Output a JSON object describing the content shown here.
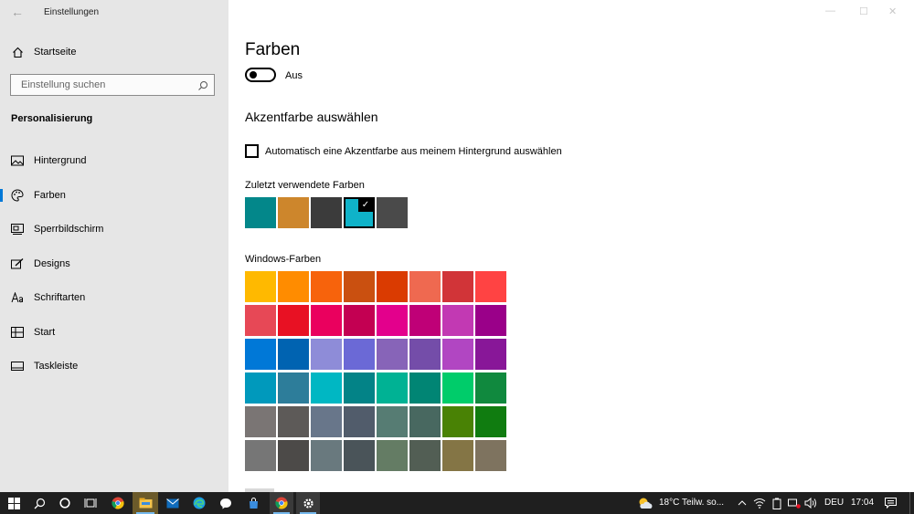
{
  "window": {
    "title": "Einstellungen",
    "back_glyph": "←",
    "minimize_glyph": "—",
    "maximize_glyph": "☐",
    "close_glyph": "✕"
  },
  "sidebar": {
    "home": {
      "label": "Startseite",
      "icon": "home-icon"
    },
    "search": {
      "placeholder": "Einstellung suchen",
      "icon": "search-icon"
    },
    "section": "Personalisierung",
    "items": [
      {
        "label": "Hintergrund",
        "icon": "picture-icon"
      },
      {
        "label": "Farben",
        "icon": "palette-icon",
        "active": true
      },
      {
        "label": "Sperrbildschirm",
        "icon": "lockscreen-icon"
      },
      {
        "label": "Designs",
        "icon": "brush-icon"
      },
      {
        "label": "Schriftarten",
        "icon": "font-icon"
      },
      {
        "label": "Start",
        "icon": "start-icon"
      },
      {
        "label": "Taskleiste",
        "icon": "taskbar-icon"
      }
    ]
  },
  "main": {
    "title": "Farben",
    "toggle": {
      "label": "Aus",
      "on": false
    },
    "accent_heading": "Akzentfarbe auswählen",
    "auto_checkbox": {
      "label": "Automatisch eine Akzentfarbe aus meinem Hintergrund auswählen",
      "checked": false
    },
    "recent_label": "Zuletzt verwendete Farben",
    "recent_colors": [
      "#03878a",
      "#cd862c",
      "#3b3b3b",
      "#0fb3c9",
      "#4a4a4a"
    ],
    "recent_selected_index": 3,
    "windows_label": "Windows-Farben",
    "windows_colors": [
      "#ffb900",
      "#ff8c00",
      "#f7630c",
      "#ca5010",
      "#da3b01",
      "#ef6950",
      "#d13438",
      "#ff4343",
      "#e74856",
      "#e81123",
      "#ea005e",
      "#c30052",
      "#e3008c",
      "#bf0077",
      "#c239b3",
      "#9a0089",
      "#0078d7",
      "#0063b1",
      "#8e8cd8",
      "#6b69d6",
      "#8764b8",
      "#744da9",
      "#b146c2",
      "#881798",
      "#0099bc",
      "#2d7d9a",
      "#00b7c3",
      "#038387",
      "#00b294",
      "#018574",
      "#00cc6a",
      "#10893e",
      "#7a7574",
      "#5d5a58",
      "#68768a",
      "#515c6b",
      "#567c73",
      "#486860",
      "#498205",
      "#107c10",
      "#767676",
      "#4c4a48",
      "#69797e",
      "#4a5459",
      "#647c64",
      "#525e54",
      "#847545",
      "#7e735f"
    ]
  },
  "taskbar": {
    "apps": [
      "start-icon",
      "search-icon",
      "cortana-icon",
      "taskview-icon",
      "chrome-icon",
      "explorer-icon",
      "mail-icon",
      "edge-icon",
      "messenger-icon",
      "store-icon",
      "chrome-icon",
      "settings-icon"
    ],
    "weather": "18°C  Teilw. so...",
    "language": "DEU",
    "time": "17:04"
  }
}
